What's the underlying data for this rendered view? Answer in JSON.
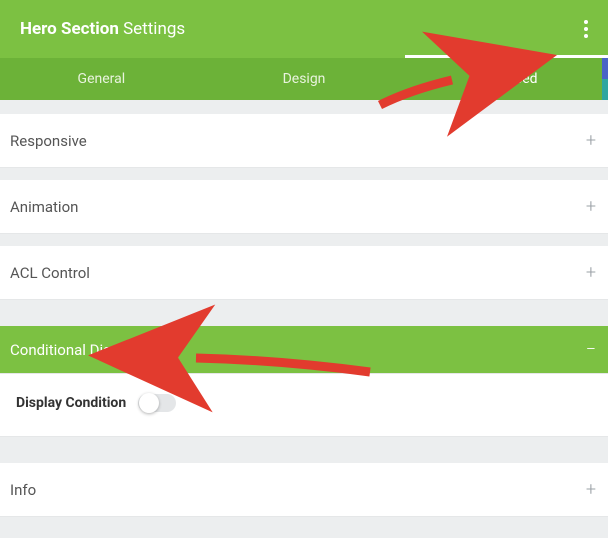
{
  "header": {
    "title_bold": "Hero Section",
    "title_rest": "Settings"
  },
  "tabs": {
    "general": "General",
    "design": "Design",
    "advanced": "Advanced"
  },
  "panels": {
    "responsive": "Responsive",
    "animation": "Animation",
    "acl": "ACL Control",
    "conditional": "Conditional Display",
    "info": "Info"
  },
  "conditional_body": {
    "label": "Display Condition"
  },
  "icons": {
    "plus": "+",
    "minus": "−"
  }
}
